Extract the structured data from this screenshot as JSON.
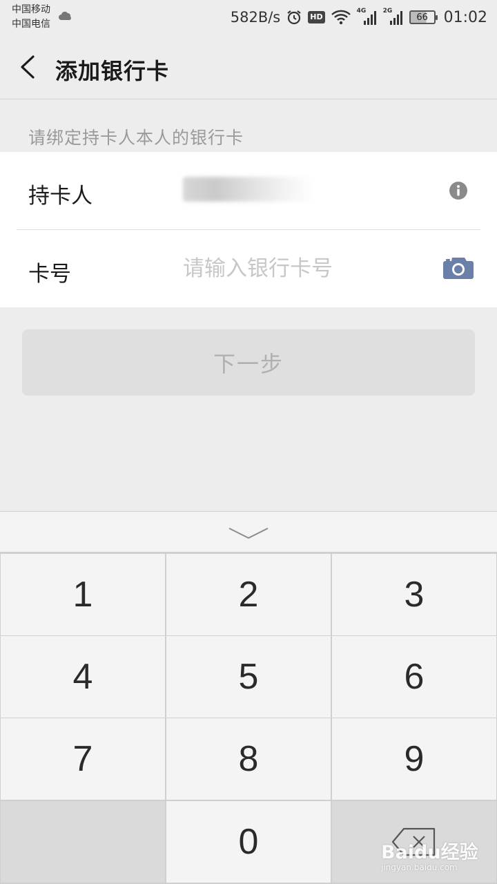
{
  "status_bar": {
    "carrier_1": "中国移动",
    "carrier_2": "中国电信",
    "net_speed": "582B/s",
    "hd_badge": "HD",
    "signal_1_tag": "4G",
    "signal_2_tag": "2G",
    "battery": "66",
    "time": "01:02",
    "icons": [
      "cloud-icon",
      "alarm-icon",
      "wifi-icon",
      "signal-icon",
      "battery-icon"
    ]
  },
  "header": {
    "title": "添加银行卡",
    "back_icon": "chevron-left-icon"
  },
  "form": {
    "hint": "请绑定持卡人本人的银行卡",
    "holder_label": "持卡人",
    "holder_value_blurred": true,
    "card_label": "卡号",
    "card_placeholder": "请输入银行卡号",
    "info_icon": "info-icon",
    "camera_icon": "camera-icon"
  },
  "actions": {
    "next_label": "下一步"
  },
  "keyboard": {
    "keys": [
      "1",
      "2",
      "3",
      "4",
      "5",
      "6",
      "7",
      "8",
      "9",
      "0"
    ],
    "collapse_icon": "chevron-down-icon",
    "delete_icon": "backspace-icon"
  },
  "watermark": {
    "main": "Baidu经验",
    "sub": "jingyan.baidu.com"
  },
  "colors": {
    "page_bg": "#ededed",
    "card_bg": "#ffffff",
    "icon_blue": "#6a80a8",
    "disabled_text": "#b0b0b0"
  }
}
